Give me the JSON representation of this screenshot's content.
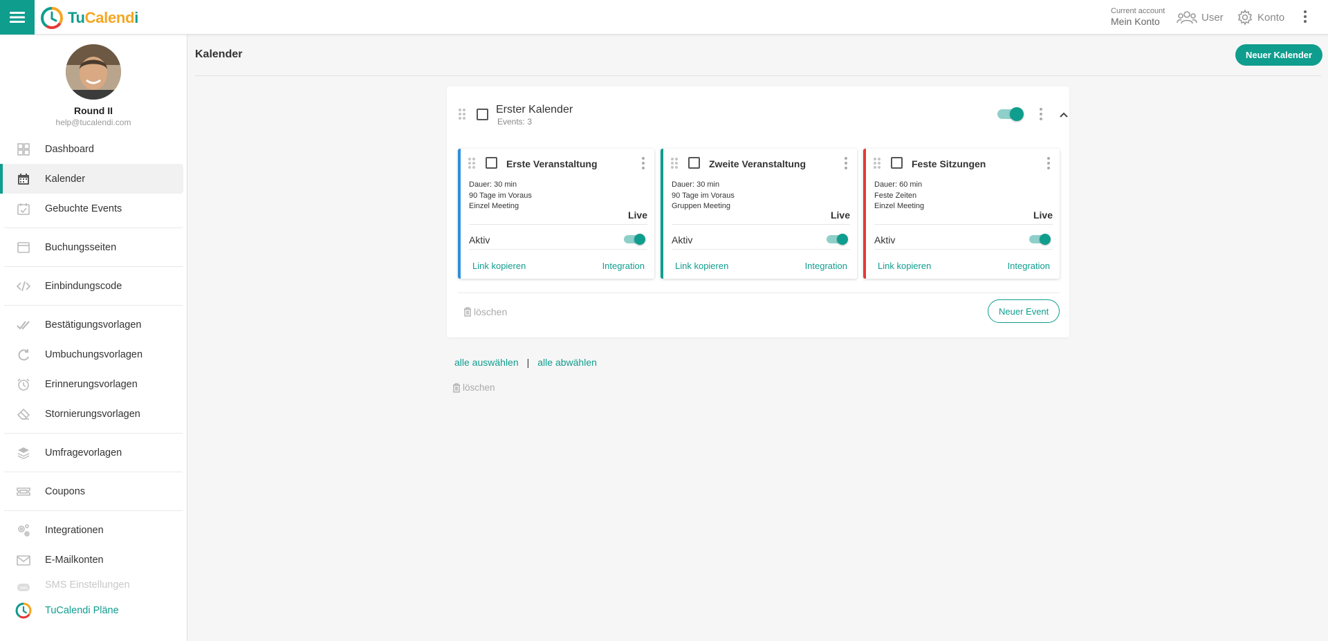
{
  "app": {
    "logo_tu": "Tu",
    "logo_calend": "Calend",
    "logo_i": "i"
  },
  "topbar": {
    "account_small": "Current account",
    "account_name": "Mein Konto",
    "user_label": "User",
    "konto_label": "Konto"
  },
  "profile": {
    "name": "Round II",
    "email": "help@tucalendi.com"
  },
  "sidebar": {
    "items": [
      {
        "label": "Dashboard",
        "icon": "dashboard-icon"
      },
      {
        "label": "Kalender",
        "icon": "calendar-icon",
        "active": true
      },
      {
        "label": "Gebuchte Events",
        "icon": "calendar-check-icon"
      },
      {
        "label": "Buchungsseiten",
        "icon": "window-icon"
      },
      {
        "label": "Einbindungscode",
        "icon": "code-icon"
      },
      {
        "label": "Bestätigungsvorlagen",
        "icon": "double-check-icon"
      },
      {
        "label": "Umbuchungsvorlagen",
        "icon": "refresh-icon"
      },
      {
        "label": "Erinnerungsvorlagen",
        "icon": "alarm-icon"
      },
      {
        "label": "Stornierungsvorlagen",
        "icon": "eraser-icon"
      },
      {
        "label": "Umfragevorlagen",
        "icon": "layers-icon"
      },
      {
        "label": "Coupons",
        "icon": "ticket-icon"
      },
      {
        "label": "Integrationen",
        "icon": "gears-icon"
      },
      {
        "label": "E-Mailkonten",
        "icon": "mail-icon"
      },
      {
        "label": "SMS Einstellungen",
        "icon": "sms-icon",
        "disabled": true
      },
      {
        "label": "TuCalendi Pläne",
        "icon": "tucalendi-logo-icon"
      }
    ]
  },
  "main": {
    "page_title": "Kalender",
    "new_calendar_label": "Neuer Kalender",
    "calendar": {
      "title": "Erster Kalender",
      "events_count": "Events: 3",
      "active": true,
      "delete_label": "löschen",
      "new_event_label": "Neuer Event"
    },
    "events": [
      {
        "title": "Erste Veranstaltung",
        "duration": "Dauer: 30 min",
        "line2": "90 Tage im Voraus",
        "line3": "Einzel Meeting",
        "status": "Live",
        "aktiv_label": "Aktiv",
        "copy_label": "Link kopieren",
        "integration_label": "Integration",
        "color": "#2f8fd8"
      },
      {
        "title": "Zweite Veranstaltung",
        "duration": "Dauer: 30 min",
        "line2": "90 Tage im Voraus",
        "line3": "Gruppen Meeting",
        "status": "Live",
        "aktiv_label": "Aktiv",
        "copy_label": "Link kopieren",
        "integration_label": "Integration",
        "color": "#0f9d8e"
      },
      {
        "title": "Feste Sitzungen",
        "duration": "Dauer: 60 min",
        "line2": "Feste Zeiten",
        "line3": "Einzel Meeting",
        "status": "Live",
        "aktiv_label": "Aktiv",
        "copy_label": "Link kopieren",
        "integration_label": "Integration",
        "color": "#e53935"
      }
    ],
    "select_all_label": "alle auswählen",
    "separator": "|",
    "deselect_all_label": "alle abwählen",
    "bulk_delete_label": "löschen"
  },
  "colors": {
    "accent": "#0f9d8e",
    "logo_orange": "#f5a623"
  }
}
